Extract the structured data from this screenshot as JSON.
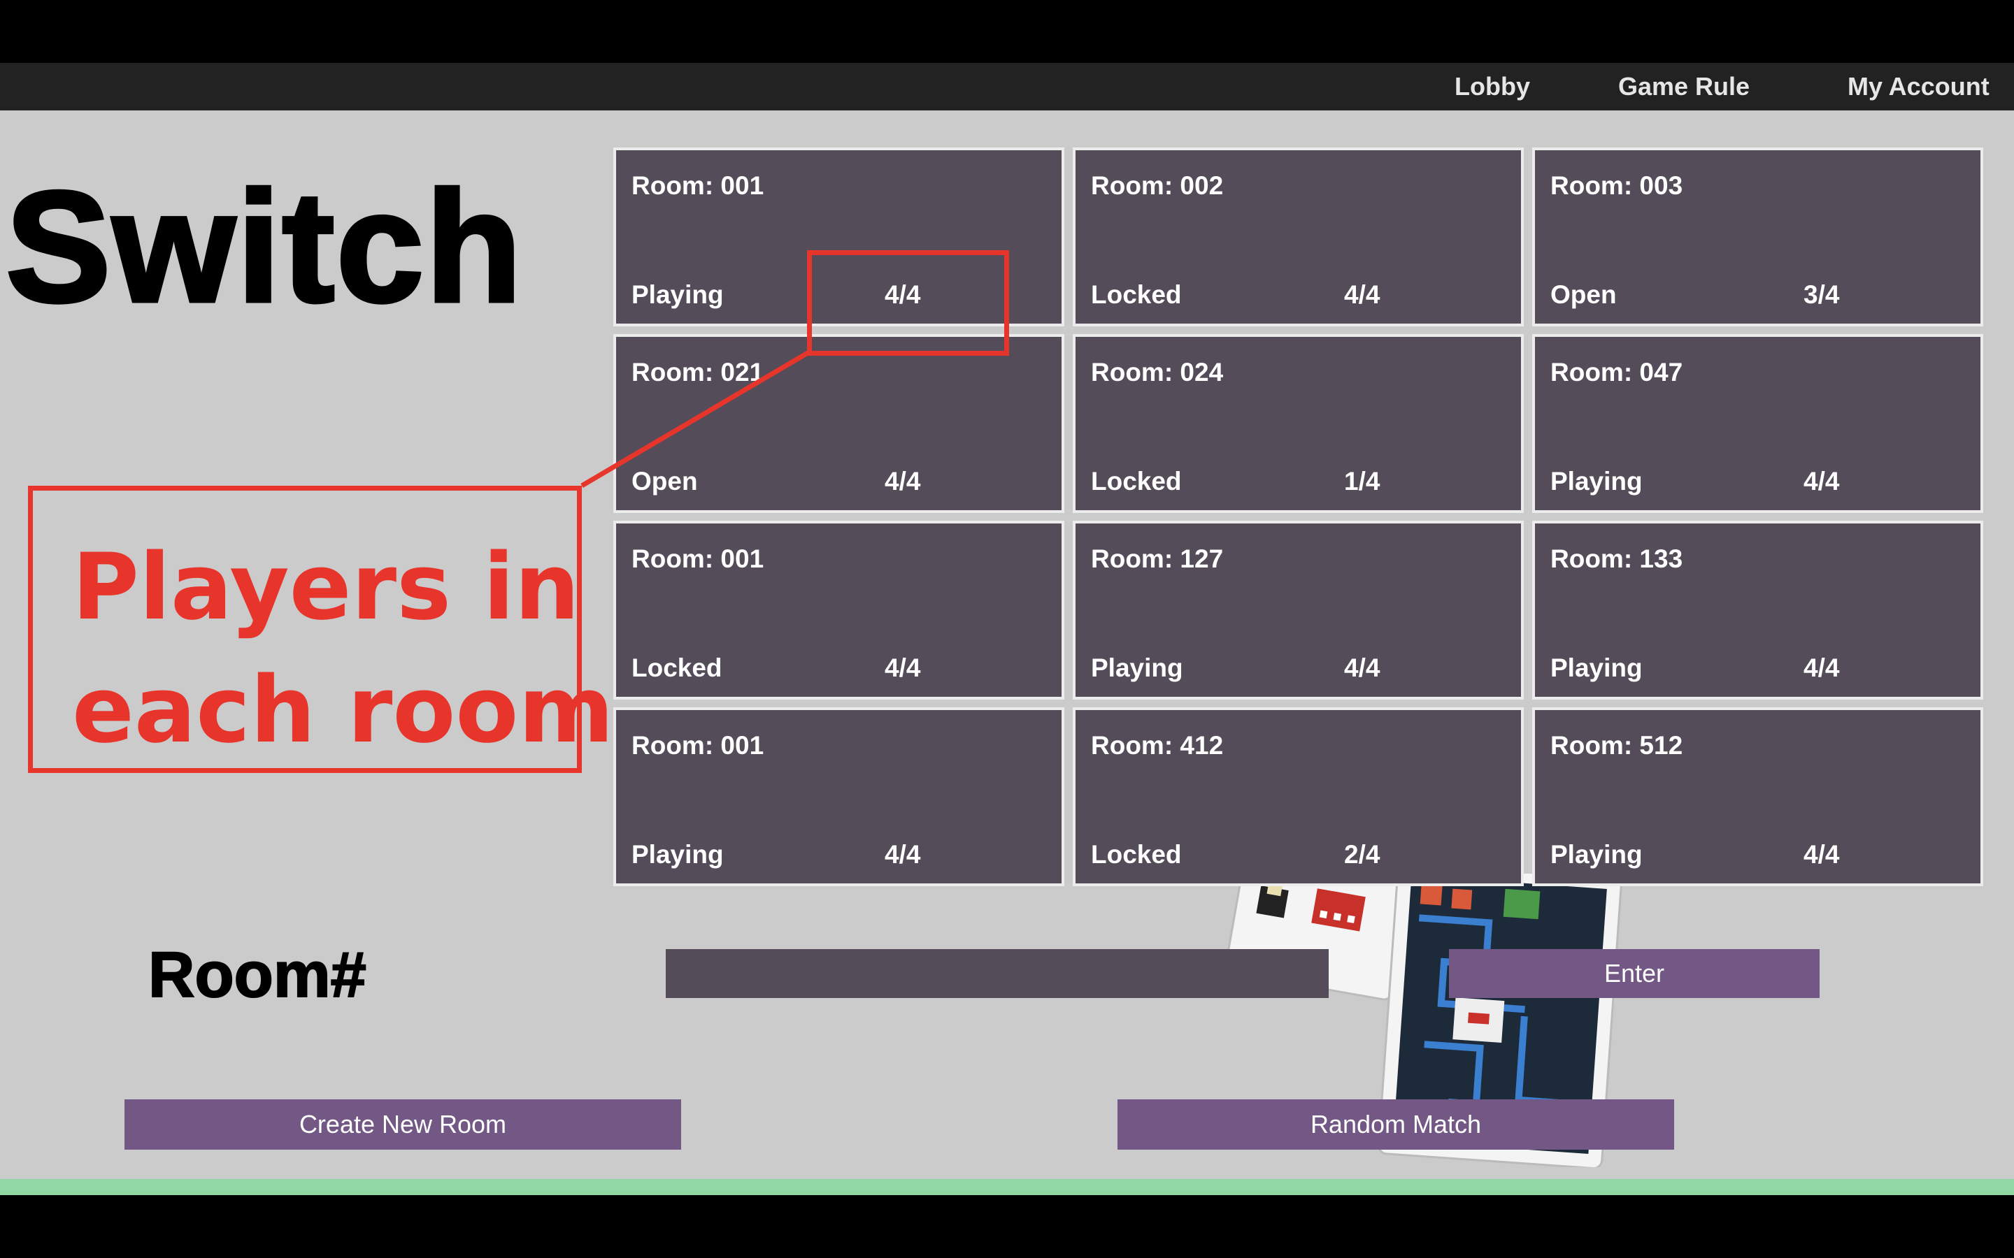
{
  "nav": {
    "items": [
      {
        "label": "Lobby"
      },
      {
        "label": "Game Rule"
      },
      {
        "label": "My Account"
      }
    ]
  },
  "logo": "Switch",
  "rooms": [
    {
      "name": "Room: 001",
      "status": "Playing",
      "players": "4/4"
    },
    {
      "name": "Room: 002",
      "status": "Locked",
      "players": "4/4"
    },
    {
      "name": "Room: 003",
      "status": "Open",
      "players": "3/4"
    },
    {
      "name": "Room: 021",
      "status": "Open",
      "players": "4/4"
    },
    {
      "name": "Room: 024",
      "status": "Locked",
      "players": "1/4"
    },
    {
      "name": "Room: 047",
      "status": "Playing",
      "players": "4/4"
    },
    {
      "name": "Room: 001",
      "status": "Locked",
      "players": "4/4"
    },
    {
      "name": "Room: 127",
      "status": "Playing",
      "players": "4/4"
    },
    {
      "name": "Room: 133",
      "status": "Playing",
      "players": "4/4"
    },
    {
      "name": "Room: 001",
      "status": "Playing",
      "players": "4/4"
    },
    {
      "name": "Room: 412",
      "status": "Locked",
      "players": "2/4"
    },
    {
      "name": "Room: 512",
      "status": "Playing",
      "players": "4/4"
    }
  ],
  "room_entry": {
    "label": "Room#",
    "input_value": "",
    "enter_label": "Enter"
  },
  "actions": {
    "create_label": "Create New Room",
    "random_label": "Random Match"
  },
  "annotation": {
    "line1": "Players in",
    "line2": "each room",
    "color": "#e8352c"
  },
  "colors": {
    "background": "#cbcbcb",
    "navbar": "#222222",
    "room_tile": "#544c59",
    "button": "#735784",
    "bottom_bar": "#8fd8a4"
  }
}
